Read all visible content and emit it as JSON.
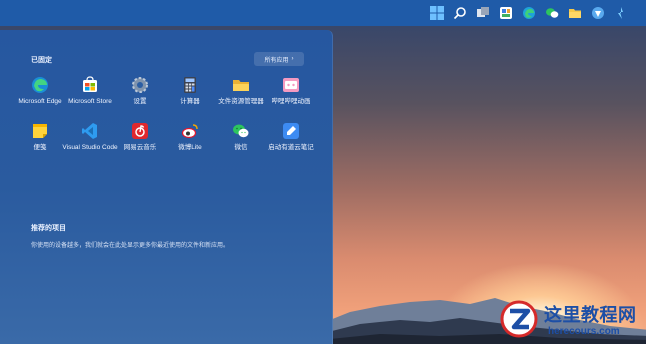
{
  "taskbar": {
    "icons": [
      "windows-start-icon",
      "search-icon",
      "task-view-icon",
      "widgets-icon",
      "edge-icon",
      "chat-icon",
      "file-explorer-icon",
      "store-icon",
      "other-app-icon"
    ]
  },
  "start_menu": {
    "pinned_title": "已固定",
    "all_apps_label": "所有应用",
    "all_apps_chevron": "›",
    "apps": [
      {
        "label": "Microsoft Edge",
        "icon": "edge-icon"
      },
      {
        "label": "Microsoft Store",
        "icon": "store-icon"
      },
      {
        "label": "设置",
        "icon": "settings-icon"
      },
      {
        "label": "计算器",
        "icon": "calculator-icon"
      },
      {
        "label": "文件资源管理器",
        "icon": "folder-icon"
      },
      {
        "label": "哔哩哔哩动画",
        "icon": "bilibili-icon"
      },
      {
        "label": "便笺",
        "icon": "sticky-notes-icon"
      },
      {
        "label": "Visual Studio Code",
        "icon": "vscode-icon"
      },
      {
        "label": "网易云音乐",
        "icon": "netease-music-icon"
      },
      {
        "label": "微博Lite",
        "icon": "weibo-icon"
      },
      {
        "label": "微信",
        "icon": "wechat-icon"
      },
      {
        "label": "启动有道云笔记",
        "icon": "youdao-note-icon"
      }
    ],
    "recommended_title": "推荐的项目",
    "recommended_desc": "你使用的设备越多，我们就会在此处显示更多你最近使用的文件和新应用。"
  },
  "watermark": {
    "title": "这里教程网",
    "url": "herecours.com"
  }
}
